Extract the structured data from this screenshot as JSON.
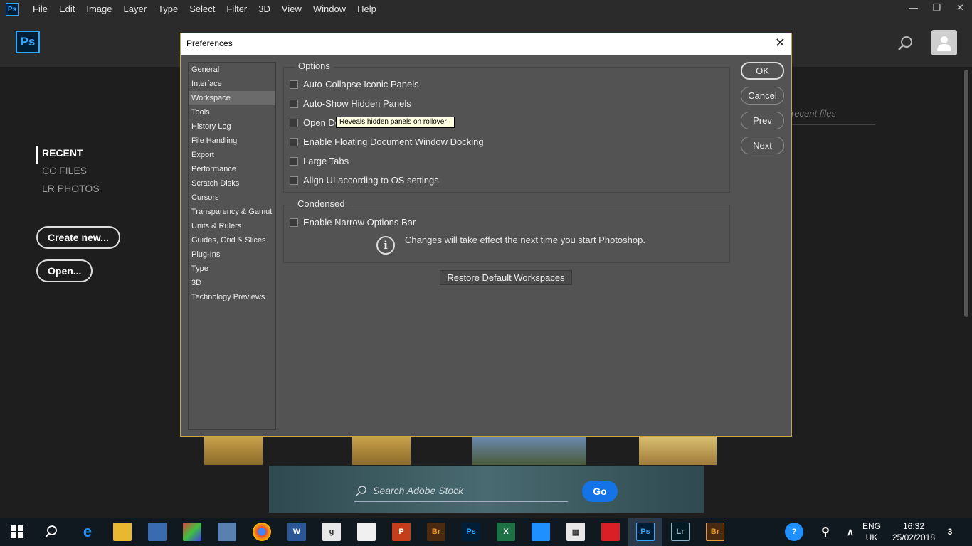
{
  "menubar": {
    "app_icon": "Ps",
    "items": [
      "File",
      "Edit",
      "Image",
      "Layer",
      "Type",
      "Select",
      "Filter",
      "3D",
      "View",
      "Window",
      "Help"
    ],
    "window_controls": {
      "minimize": "—",
      "restore": "❐",
      "close": "✕"
    }
  },
  "header": {
    "logo": "Ps"
  },
  "start": {
    "nav": [
      "RECENT",
      "CC FILES",
      "LR PHOTOS"
    ],
    "create_new": "Create new...",
    "open": "Open...",
    "recent_files_placeholder": "recent files"
  },
  "stock": {
    "placeholder": "Search Adobe Stock",
    "go": "Go"
  },
  "dialog": {
    "title": "Preferences",
    "close": "✕",
    "categories": [
      "General",
      "Interface",
      "Workspace",
      "Tools",
      "History Log",
      "File Handling",
      "Export",
      "Performance",
      "Scratch Disks",
      "Cursors",
      "Transparency & Gamut",
      "Units & Rulers",
      "Guides, Grid & Slices",
      "Plug-Ins",
      "Type",
      "3D",
      "Technology Previews"
    ],
    "selected_category": "Workspace",
    "options_group": {
      "title": "Options",
      "items": [
        "Auto-Collapse Iconic Panels",
        "Auto-Show Hidden Panels",
        "Open Dc",
        "Enable Floating Document Window Docking",
        "Large Tabs",
        "Align UI according to OS settings"
      ]
    },
    "tooltip": "Reveals hidden panels on rollover",
    "condensed_group": {
      "title": "Condensed",
      "items": [
        "Enable Narrow Options Bar"
      ],
      "info": "Changes will take effect the next time you start Photoshop."
    },
    "restore": "Restore Default Workspaces",
    "buttons": {
      "ok": "OK",
      "cancel": "Cancel",
      "prev": "Prev",
      "next": "Next"
    }
  },
  "taskbar": {
    "lang": "ENG",
    "region": "UK",
    "time": "16:32",
    "date": "25/02/2018",
    "notifications": "3"
  }
}
